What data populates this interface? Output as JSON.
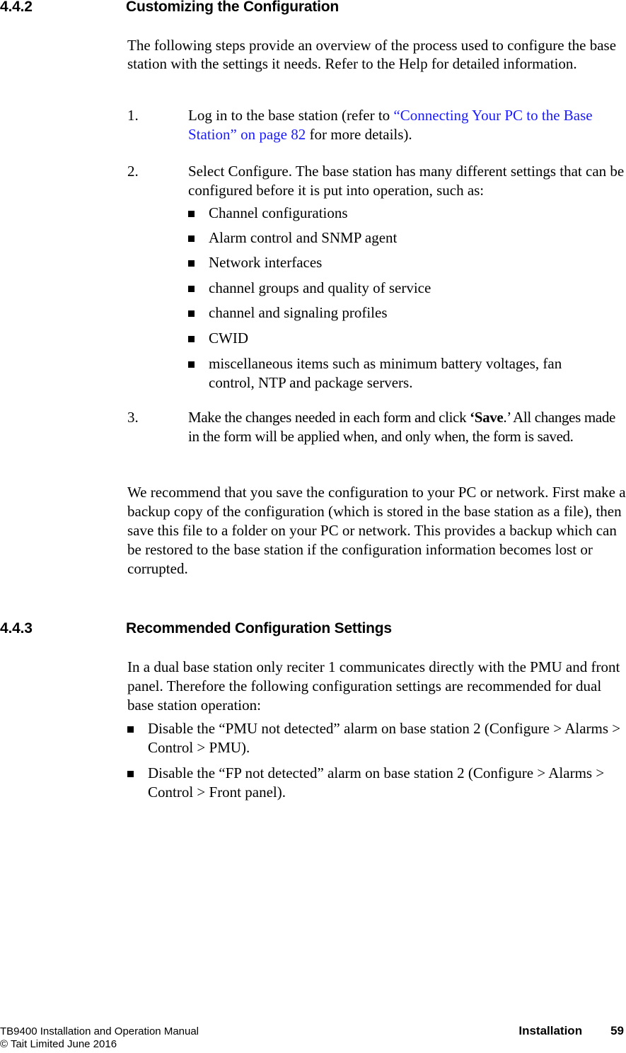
{
  "section_442": {
    "number": "4.4.2",
    "title": "Customizing the Configuration",
    "intro": "The following steps provide an overview of the process used to configure the base station with the settings it needs. Refer to the Help for detailed information.",
    "steps": [
      {
        "number": "1.",
        "text_before": "Log in to the base station (refer to ",
        "link": "“Connecting Your PC to the Base Station” on page 82",
        "text_after": " for more details)."
      },
      {
        "number": "2.",
        "text": "Select Configure. The base station has many different settings that can be configured before it is put into operation, such as:",
        "bullets": [
          "Channel configurations",
          "Alarm control and SNMP agent",
          "Network interfaces",
          "channel groups and quality of service",
          "channel and signaling profiles",
          "CWID",
          "miscellaneous items such as minimum battery voltages, fan control, NTP and package servers."
        ]
      },
      {
        "number": "3.",
        "text_before": "Make the changes needed in each form and click ",
        "bold": "‘Save",
        "text_after": ".’ All changes made in the form will be applied when, and only when, the form is saved."
      }
    ],
    "recommendation": "We recommend that you save the configuration to your PC or network. First make a backup copy of the configuration (which is stored in the base station as a file), then save this file to a folder on your PC or network. This provides a backup which can be restored to the base station if the configuration information becomes lost or corrupted."
  },
  "section_443": {
    "number": "4.4.3",
    "title": "Recommended Configuration Settings",
    "intro": "In a dual base station only reciter 1 communicates directly with the PMU and front panel. Therefore the following configuration settings are recommended for dual base station operation:",
    "bullets": [
      "Disable the “PMU not detected” alarm on base station 2 (Configure > Alarms > Control > PMU).",
      "Disable the “FP not detected” alarm on base station 2 (Configure > Alarms > Control > Front panel)."
    ]
  },
  "footer": {
    "manual_title": "TB9400 Installation and Operation Manual",
    "copyright": "© Tait Limited June 2016",
    "section": "Installation",
    "page_number": "59"
  },
  "colors": {
    "link": "#1a1aff",
    "text": "#000000"
  }
}
